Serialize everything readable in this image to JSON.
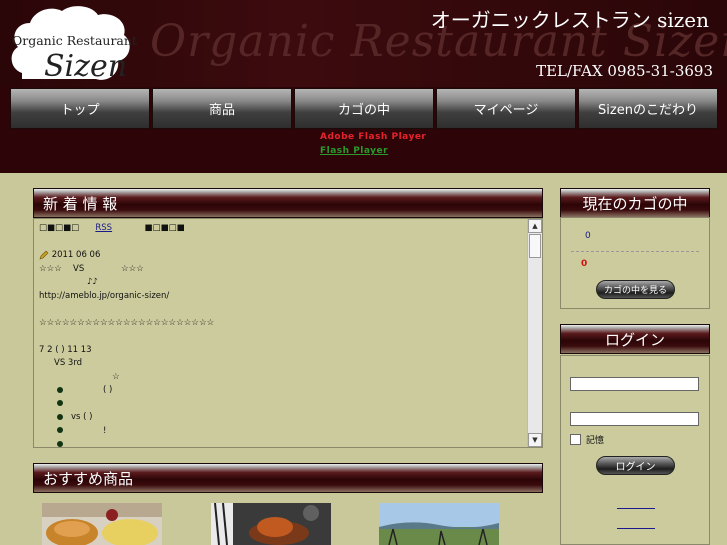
{
  "header": {
    "bg_text": "Organic Restaurant Sizen",
    "logo_line1": "Organic Restaurant",
    "logo_line2": "Sizen",
    "title": "オーガニックレストラン sizen",
    "tel": "TEL/FAX 0985-31-3693"
  },
  "nav": {
    "items": [
      {
        "label": "トップ"
      },
      {
        "label": "商品"
      },
      {
        "label": "カゴの中"
      },
      {
        "label": "マイページ"
      },
      {
        "label": "Sizenのこだわり"
      }
    ],
    "flash_notice": "Adobe Flash Player",
    "flash_link": "Flash Player"
  },
  "news": {
    "title": "新 着 情 報",
    "rss_label": "RSS",
    "marks_left": "□■□■□",
    "marks_right": "■□■□■",
    "date": "2011 06 06",
    "line_vs": "☆☆☆　 VS 　　　　☆☆☆",
    "line_notes": "♪♪",
    "url": "http://ameblo.jp/organic-sizen/",
    "stars": "☆☆☆☆☆☆☆☆☆☆☆☆☆☆☆☆☆☆☆☆☆☆☆",
    "line_date2": "7 2 ( ) 11   13",
    "line_3rd": "VS    3rd",
    "line_star": "☆",
    "bullet1": "(         )",
    "bullet3": "vs   (    )",
    "bullet4": "!"
  },
  "recommend": {
    "title": "おすすめ商品"
  },
  "cart": {
    "title": "現在のカゴの中",
    "count": "0",
    "total": "0",
    "view_button": "カゴの中を見る"
  },
  "login": {
    "title": "ログイン",
    "remember_label": "記憶",
    "login_button": "ログイン"
  },
  "colors": {
    "page_bg": "#c9c89a",
    "header_bg": "#2d0508",
    "price_red": "#d01010",
    "link_blue": "#1a1a8a"
  }
}
